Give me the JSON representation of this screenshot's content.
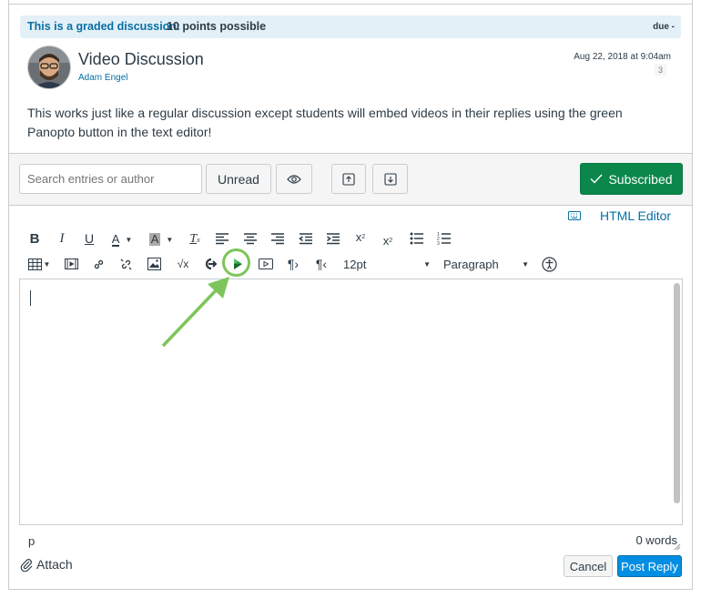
{
  "graded": {
    "label": "This is a graded discussion:",
    "points": "10 points possible",
    "due": "due -"
  },
  "topic": {
    "title": "Video Discussion",
    "author": "Adam Engel",
    "date": "Aug 22, 2018 at 9:04am",
    "count": "3",
    "body": "This works just like a regular discussion except students will embed videos in their replies using the green Panopto button in the text editor!"
  },
  "toolbar": {
    "search_placeholder": "Search entries or author",
    "unread": "Unread",
    "subscribed": "Subscribed"
  },
  "editor": {
    "html_editor": "HTML Editor",
    "font_size": "12pt",
    "block_format": "Paragraph",
    "path": "p",
    "word_count": "0 words"
  },
  "footer": {
    "attach": "Attach",
    "cancel": "Cancel",
    "post_reply": "Post Reply"
  },
  "colors": {
    "accent": "#0770a3",
    "subscribed": "#0b874b",
    "post": "#008ee2",
    "highlight": "#7dc55b",
    "panopto": "#2f9e45"
  }
}
